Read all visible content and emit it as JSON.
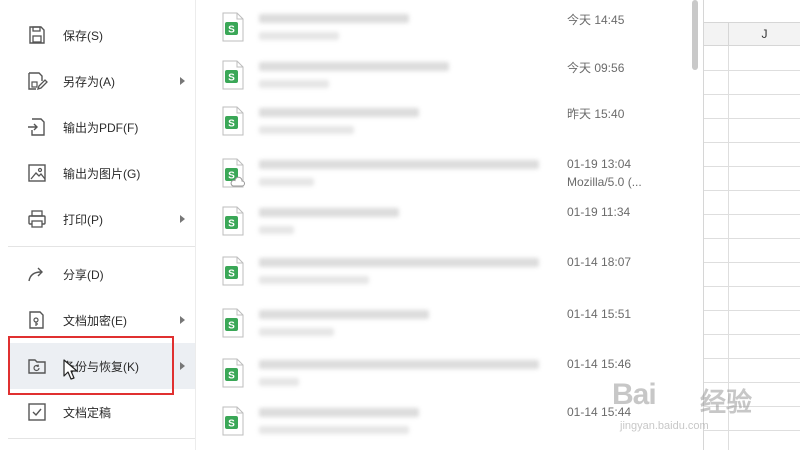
{
  "menu": {
    "items": [
      {
        "label": "保存(S)",
        "icon": "save-icon",
        "submenu": false
      },
      {
        "label": "另存为(A)",
        "icon": "save-as-icon",
        "submenu": true
      },
      {
        "label": "输出为PDF(F)",
        "icon": "export-pdf-icon",
        "submenu": false
      },
      {
        "label": "输出为图片(G)",
        "icon": "export-image-icon",
        "submenu": false
      },
      {
        "label": "打印(P)",
        "icon": "print-icon",
        "submenu": true
      },
      {
        "label": "分享(D)",
        "icon": "share-icon",
        "submenu": false
      },
      {
        "label": "文档加密(E)",
        "icon": "encrypt-icon",
        "submenu": true
      },
      {
        "label": "备份与恢复(K)",
        "icon": "backup-restore-icon",
        "submenu": true,
        "hovered": true
      },
      {
        "label": "文档定稿",
        "icon": "finalize-icon",
        "submenu": false
      }
    ]
  },
  "recent_files": [
    {
      "time": "今天  14:45",
      "icon": "spreadsheet-file-icon"
    },
    {
      "time": "今天  09:56",
      "icon": "spreadsheet-file-icon"
    },
    {
      "time": "昨天  15:40",
      "icon": "spreadsheet-file-icon"
    },
    {
      "time": "01-19 13:04",
      "sub": "Mozilla/5.0 (...",
      "icon": "spreadsheet-cloud-file-icon"
    },
    {
      "time": "01-19 11:34",
      "icon": "spreadsheet-file-icon"
    },
    {
      "time": "01-14 18:07",
      "icon": "spreadsheet-file-icon"
    },
    {
      "time": "01-14 15:51",
      "icon": "spreadsheet-file-icon"
    },
    {
      "time": "01-14 15:46",
      "icon": "spreadsheet-file-icon"
    },
    {
      "time": "01-14 15:44",
      "icon": "spreadsheet-file-icon"
    }
  ],
  "sheet": {
    "column_label": "J"
  },
  "watermark": {
    "brand": "Bai",
    "brand_cn": "经验",
    "url": "jingyan.baidu.com"
  },
  "colors": {
    "accent_green": "#3aa757",
    "highlight_red": "#e03030"
  }
}
